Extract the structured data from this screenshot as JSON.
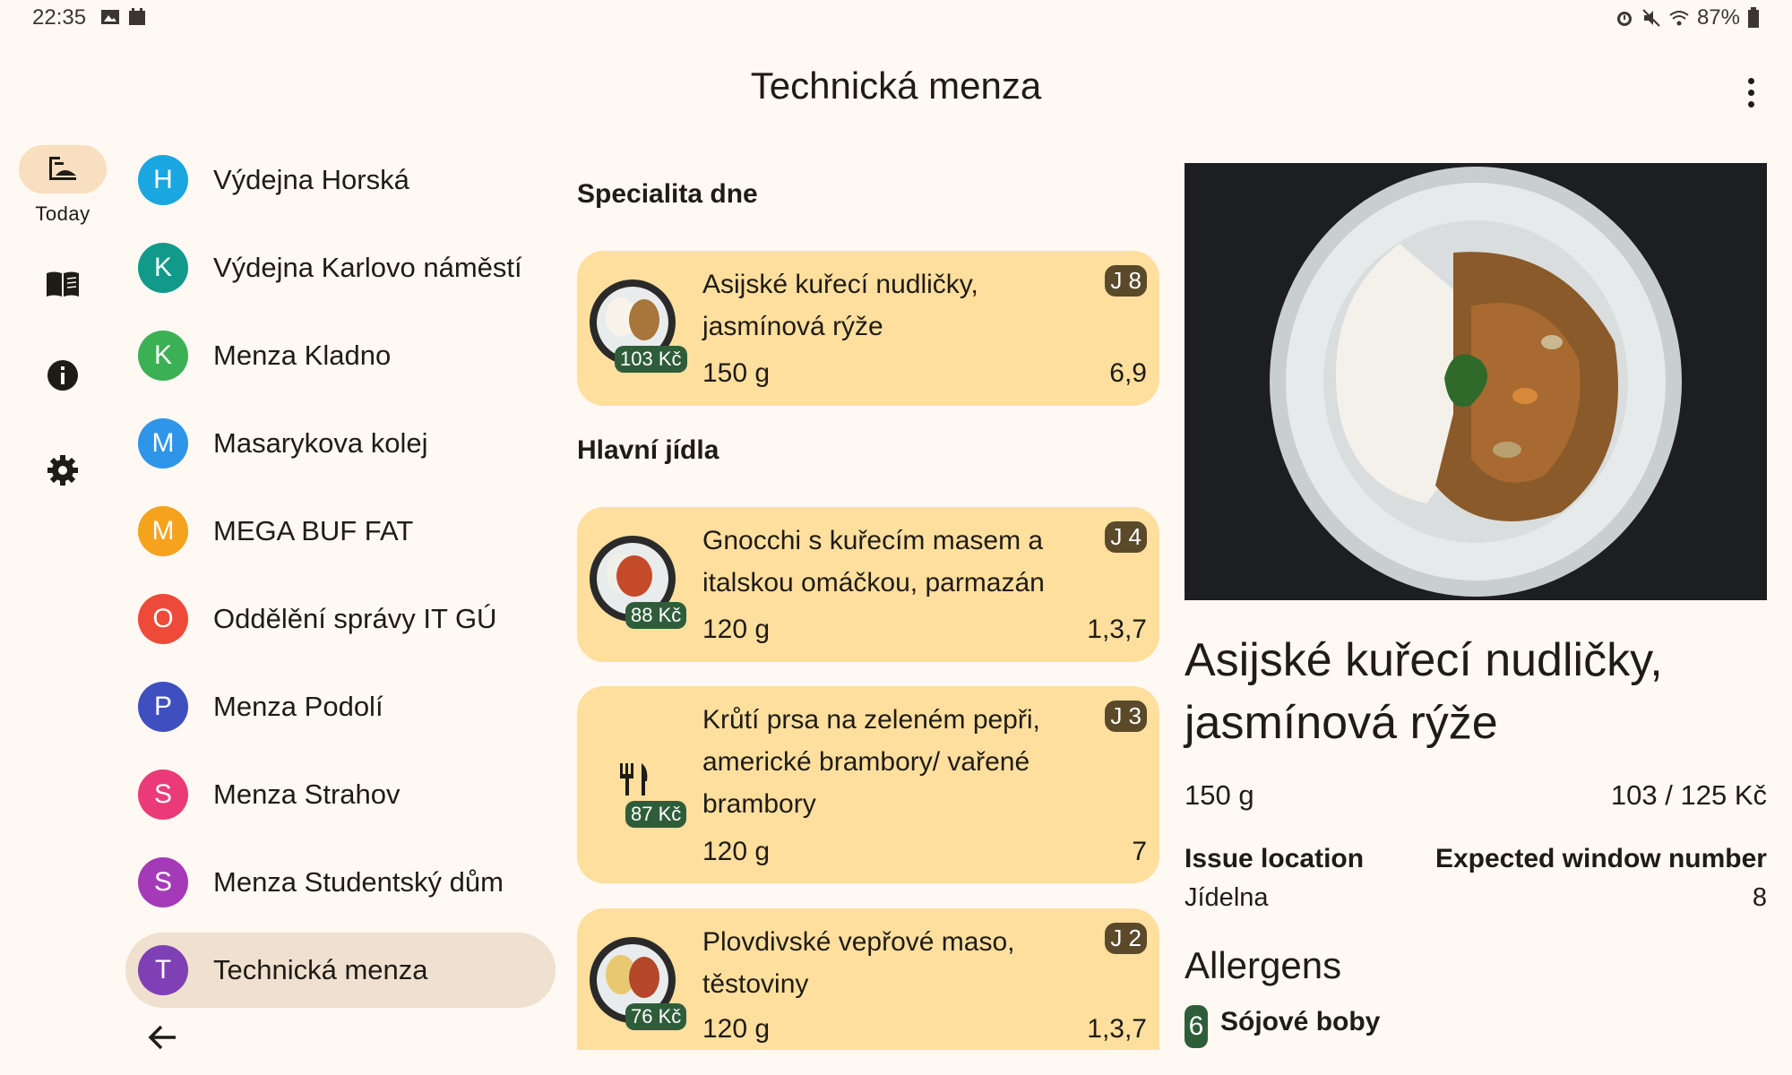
{
  "status_bar": {
    "time": "22:35",
    "battery": "87%"
  },
  "app_bar": {
    "title": "Technická menza"
  },
  "rail": {
    "items": [
      {
        "icon": "canteen-icon",
        "label": "Today"
      },
      {
        "icon": "book-icon",
        "label": ""
      },
      {
        "icon": "info-icon",
        "label": ""
      },
      {
        "icon": "settings-icon",
        "label": ""
      }
    ]
  },
  "locations": [
    {
      "initial": "H",
      "name": "Výdejna Horská",
      "color": "#1aa6e0"
    },
    {
      "initial": "K",
      "name": "Výdejna Karlovo náměstí",
      "color": "#119a8a"
    },
    {
      "initial": "K",
      "name": "Menza Kladno",
      "color": "#3cb055"
    },
    {
      "initial": "M",
      "name": "Masarykova kolej",
      "color": "#2f95e8"
    },
    {
      "initial": "M",
      "name": "MEGA BUF FAT",
      "color": "#f5a21d"
    },
    {
      "initial": "O",
      "name": "Oddělění správy IT GÚ",
      "color": "#ee4a3a"
    },
    {
      "initial": "P",
      "name": "Menza Podolí",
      "color": "#3f4fc0"
    },
    {
      "initial": "S",
      "name": "Menza Strahov",
      "color": "#ea3a77"
    },
    {
      "initial": "S",
      "name": "Menza Studentský dům",
      "color": "#a43ab8"
    },
    {
      "initial": "T",
      "name": "Technická menza",
      "color": "#7f3fb5"
    }
  ],
  "menu": {
    "sections": [
      {
        "title": "Specialita dne"
      },
      {
        "title": "Hlavní jídla"
      }
    ],
    "dishes": [
      {
        "name": "Asijské kuřecí nudličky, jasmínová rýže",
        "price": "103 Kč",
        "code": "J 8",
        "weight": "150 g",
        "allergens": "6,9"
      },
      {
        "name": "Gnocchi s kuřecím masem a italskou omáčkou, parmazán",
        "price": "88 Kč",
        "code": "J 4",
        "weight": "120 g",
        "allergens": "1,3,7"
      },
      {
        "name": "Krůtí prsa na zeleném pepři, americké brambory/ vařené brambory",
        "price": "87 Kč",
        "code": "J 3",
        "weight": "120 g",
        "allergens": "7"
      },
      {
        "name": "Plovdivské vepřové maso, těstoviny",
        "price": "76 Kč",
        "code": "J 2",
        "weight": "120 g",
        "allergens": "1,3,7"
      }
    ]
  },
  "detail": {
    "title": "Asijské kuřecí nudličky, jasmínová rýže",
    "weight": "150 g",
    "price": "103 / 125 Kč",
    "issue_location_label": "Issue location",
    "issue_location_value": "Jídelna",
    "window_label": "Expected window number",
    "window_value": "8",
    "allergens_title": "Allergens",
    "allergen_number": "6",
    "allergen_name": "Sójové boby"
  },
  "colors": {
    "card": "#fedf9e",
    "price_badge": "#2f5d3a",
    "selected_location": "#efe0cf",
    "rail_active": "#f7dfbf"
  }
}
